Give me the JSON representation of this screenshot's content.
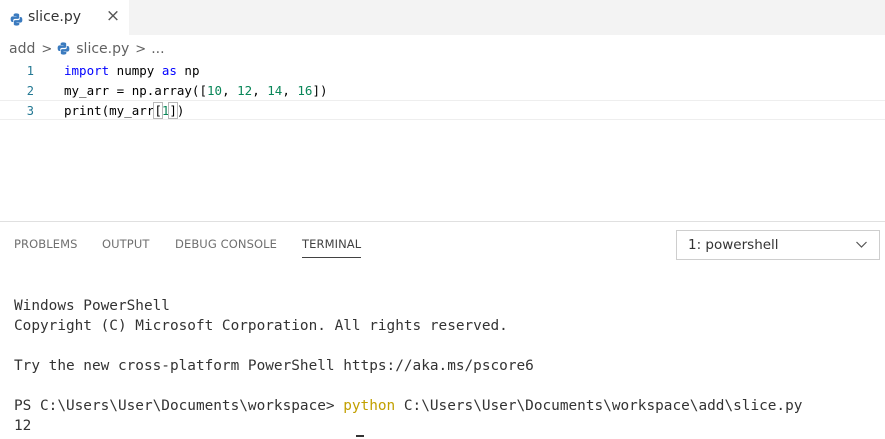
{
  "tab": {
    "label": "slice.py",
    "close_icon": "×",
    "icon": "python-icon"
  },
  "breadcrumb": {
    "folder": "add",
    "sep1": ">",
    "file": "slice.py",
    "sep2": ">",
    "more": "..."
  },
  "editor": {
    "lines": [
      {
        "number": "1",
        "parts": {
          "kw": "import",
          "a": " numpy ",
          "kw2": "as",
          "b": " np"
        }
      },
      {
        "number": "2",
        "parts": {
          "a": "my_arr = np.array([",
          "n1": "10",
          "c1": ", ",
          "n2": "12",
          "c2": ", ",
          "n3": "14",
          "c3": ", ",
          "n4": "16",
          "b": "])"
        }
      },
      {
        "number": "3",
        "parts": {
          "a": "print(my_arr",
          "br_open": "[",
          "n1": "1",
          "br_close": "]",
          "b": ")"
        }
      }
    ]
  },
  "panel": {
    "tabs": [
      "PROBLEMS",
      "OUTPUT",
      "DEBUG CONSOLE",
      "TERMINAL"
    ],
    "active_tab": "TERMINAL",
    "terminal_select": "1: powershell"
  },
  "terminal": {
    "line1": "Windows PowerShell",
    "line2": "Copyright (C) Microsoft Corporation. All rights reserved.",
    "line3": "Try the new cross-platform PowerShell https://aka.ms/pscore6",
    "prompt": "PS C:\\Users\\User\\Documents\\workspace> ",
    "command": "python",
    "command_arg": " C:\\Users\\User\\Documents\\workspace\\add\\slice.py",
    "output": "12"
  },
  "colors": {
    "keyword": "#0000ff",
    "number": "#098658",
    "line_number": "#237893",
    "terminal_command": "#c2a000"
  }
}
